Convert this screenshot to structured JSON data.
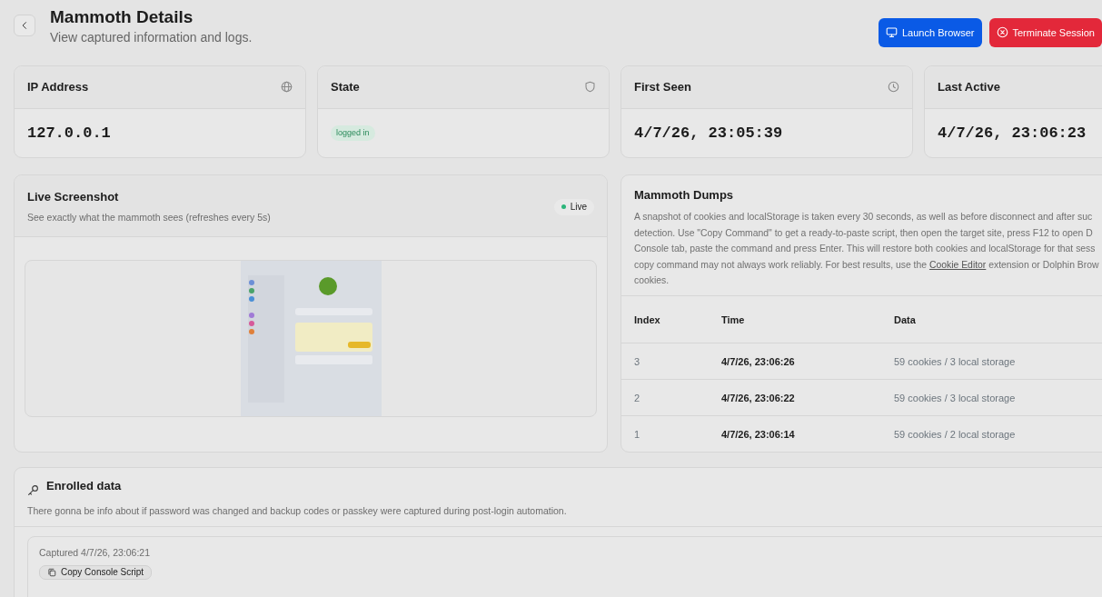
{
  "header": {
    "title": "Mammoth Details",
    "subtitle": "View captured information and logs.",
    "buttons": [
      {
        "label": "Launch Browser",
        "kind": "primary"
      },
      {
        "label": "Terminate Session",
        "kind": "danger"
      }
    ]
  },
  "stats": [
    {
      "label": "IP Address",
      "value": "127.0.0.1",
      "kind": "mono"
    },
    {
      "label": "State",
      "value": "logged in",
      "kind": "badge"
    },
    {
      "label": "First Seen",
      "value": "4/7/26, 23:05:39",
      "kind": "mono"
    },
    {
      "label": "Last Active",
      "value": "4/7/26, 23:06:23",
      "kind": "mono"
    }
  ],
  "live": {
    "title": "Live Screenshot",
    "subtitle": "See exactly what the mammoth sees (refreshes every 5s)",
    "badge": "Live"
  },
  "dumps": {
    "title": "Mammoth Dumps",
    "description_lines": [
      {
        "text": "A snapshot of cookies and localStorage is taken every 30 seconds, as well as before disconnect and after suc"
      },
      {
        "text": "detection. Use \"Copy Command\" to get a ready-to-paste script, then open the target site, press F12 to open D"
      },
      {
        "text": "Console tab, paste the command and press Enter. This will restore both cookies and localStorage for that sess"
      },
      {
        "text": "copy command may not always work reliably. For best results, use the ",
        "link": "Cookie Editor",
        "after": " extension or Dolphin Brow"
      },
      {
        "text": "cookies."
      }
    ],
    "table": {
      "columns": [
        "Index",
        "Time",
        "Data"
      ],
      "rows": [
        {
          "index": "3",
          "time": "4/7/26, 23:06:26",
          "data": "59 cookies / 3 local storage"
        },
        {
          "index": "2",
          "time": "4/7/26, 23:06:22",
          "data": "59 cookies / 3 local storage"
        },
        {
          "index": "1",
          "time": "4/7/26, 23:06:14",
          "data": "59 cookies / 2 local storage"
        }
      ]
    }
  },
  "enrolled": {
    "title": "Enrolled data",
    "description": "There gonna be info about if password was changed and backup codes or passkey were captured during post-login automation.",
    "entry": {
      "captured": "Captured 4/7/26, 23:06:21",
      "button": "Copy Console Script"
    }
  }
}
